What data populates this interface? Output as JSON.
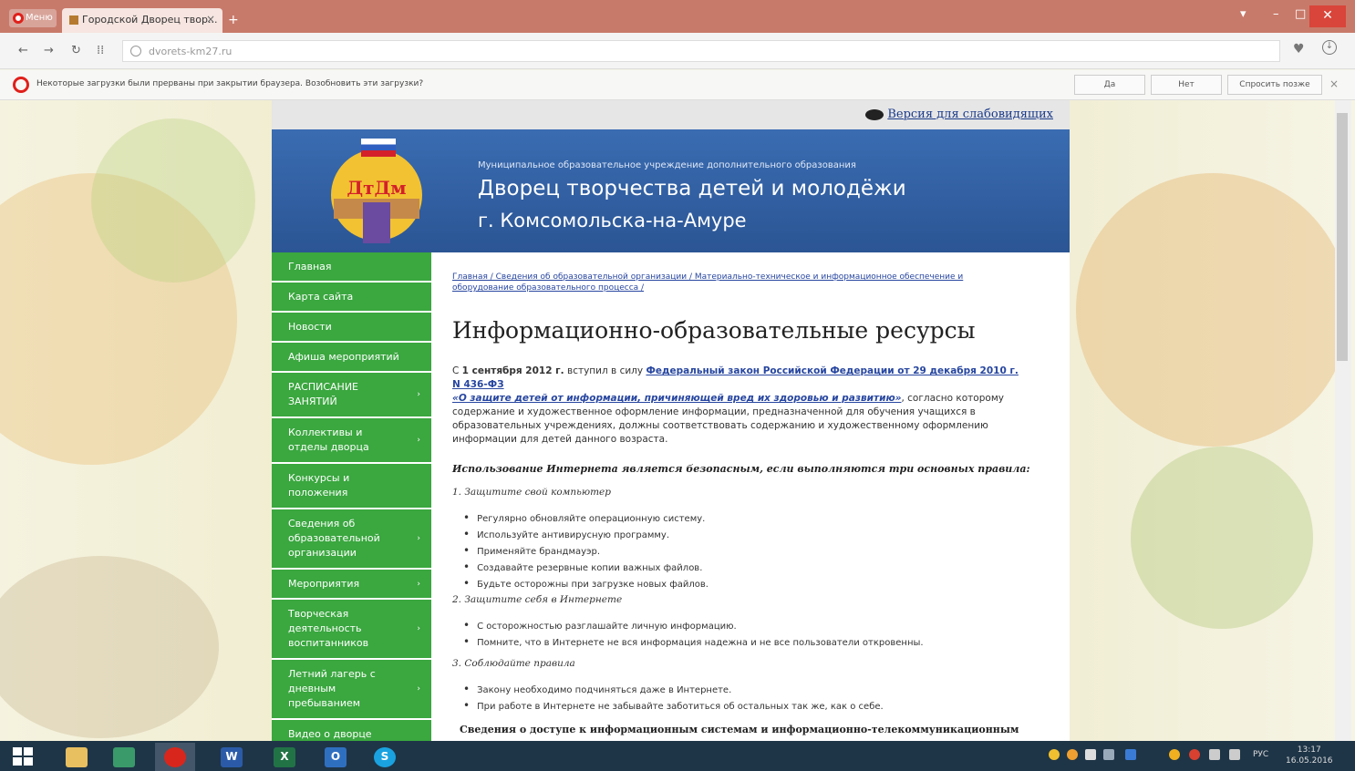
{
  "browser": {
    "menu_label": "Меню",
    "tab_title": "Городской Дворец твор...",
    "tab_close": "×",
    "tab_add": "+",
    "address": "dvorets-km27.ru",
    "info_message": "Некоторые загрузки были прерваны при закрытии браузера. Возобновить эти загрузки?",
    "info_yes": "Да",
    "info_no": "Нет",
    "info_later": "Спросить позже",
    "info_close": "×"
  },
  "site": {
    "accessibility_link": "Версия для слабовидящих",
    "logo_text": "ДтДм",
    "banner_subtitle": "Муниципальное образовательное учреждение дополнительного образования",
    "banner_title_1": "Дворец творчества детей и молодёжи",
    "banner_title_2": "г. Комсомольска-на-Амуре",
    "menu": [
      {
        "label": "Главная",
        "arrow": ""
      },
      {
        "label": "Карта сайта",
        "arrow": ""
      },
      {
        "label": "Новости",
        "arrow": ""
      },
      {
        "label": "Афиша мероприятий",
        "arrow": ""
      },
      {
        "label": "РАСПИСАНИЕ ЗАНЯТИЙ",
        "arrow": "›"
      },
      {
        "label": "Коллективы и отделы дворца",
        "arrow": "›"
      },
      {
        "label": "Конкурсы и положения",
        "arrow": ""
      },
      {
        "label": "Сведения об образовательной организации",
        "arrow": "›"
      },
      {
        "label": "Мероприятия",
        "arrow": "›"
      },
      {
        "label": "Творческая деятельность воспитанников",
        "arrow": "›"
      },
      {
        "label": "Летний лагерь с дневным пребыванием",
        "arrow": "›"
      },
      {
        "label": "Видео о дворце",
        "arrow": ""
      }
    ],
    "breadcrumb": "Главная / Сведения об образовательной организации / Материально-техническое и информационное обеспечение и оборудование образовательного процесса /",
    "heading": "Информационно-образовательные ресурсы",
    "intro_start": "С ",
    "intro_date": "1 сентября 2012 г.",
    "intro_mid": " вступил в силу ",
    "intro_law": "Федеральный закон Российской Федерации от 29 декабря 2010 г. N 436-ФЗ",
    "intro_law_title": "«О защите детей от информации, причиняющей вред их здоровью и развитию»",
    "intro_end": ", согласно которому содержание и художественное оформление информации, предназначенной для обучения учащихся в образовательных учреждениях, должны соответствовать содержанию и художественному оформлению информации для детей данного возраста.",
    "rules_heading": "Использование Интернета является безопасным, если выполняются три основных правила:",
    "rule1_title": "1. Защитите свой компьютер",
    "rule1_items": [
      "Регулярно обновляйте операционную систему.",
      "Используйте антивирусную программу.",
      "Применяйте брандмауэр.",
      "Создавайте резервные копии важных файлов.",
      "Будьте осторожны при загрузке новых файлов."
    ],
    "rule2_title": "2. Защитите себя в Интернете",
    "rule2_items": [
      "С осторожностью разглашайте личную информацию.",
      "Помните, что в Интернете не вся информация надежна и не все пользователи откровенны."
    ],
    "rule3_title": "3. Соблюдайте правила",
    "rule3_items": [
      "Закону необходимо подчиняться даже в Интернете.",
      "При работе в Интернете не забывайте заботиться об остальных так же, как о себе."
    ],
    "bottom_heading": "Сведения о доступе к информационным системам и информационно-телекоммуникационным"
  },
  "taskbar": {
    "apps": [
      "explorer",
      "network",
      "opera",
      "word",
      "excel",
      "outlook",
      "skype"
    ],
    "lang": "РУС",
    "time": "13:17",
    "date": "16.05.2016"
  },
  "colors": {
    "menu_green": "#3aa73f",
    "banner_blue": "#2b5594",
    "link_blue": "#2746a0"
  }
}
